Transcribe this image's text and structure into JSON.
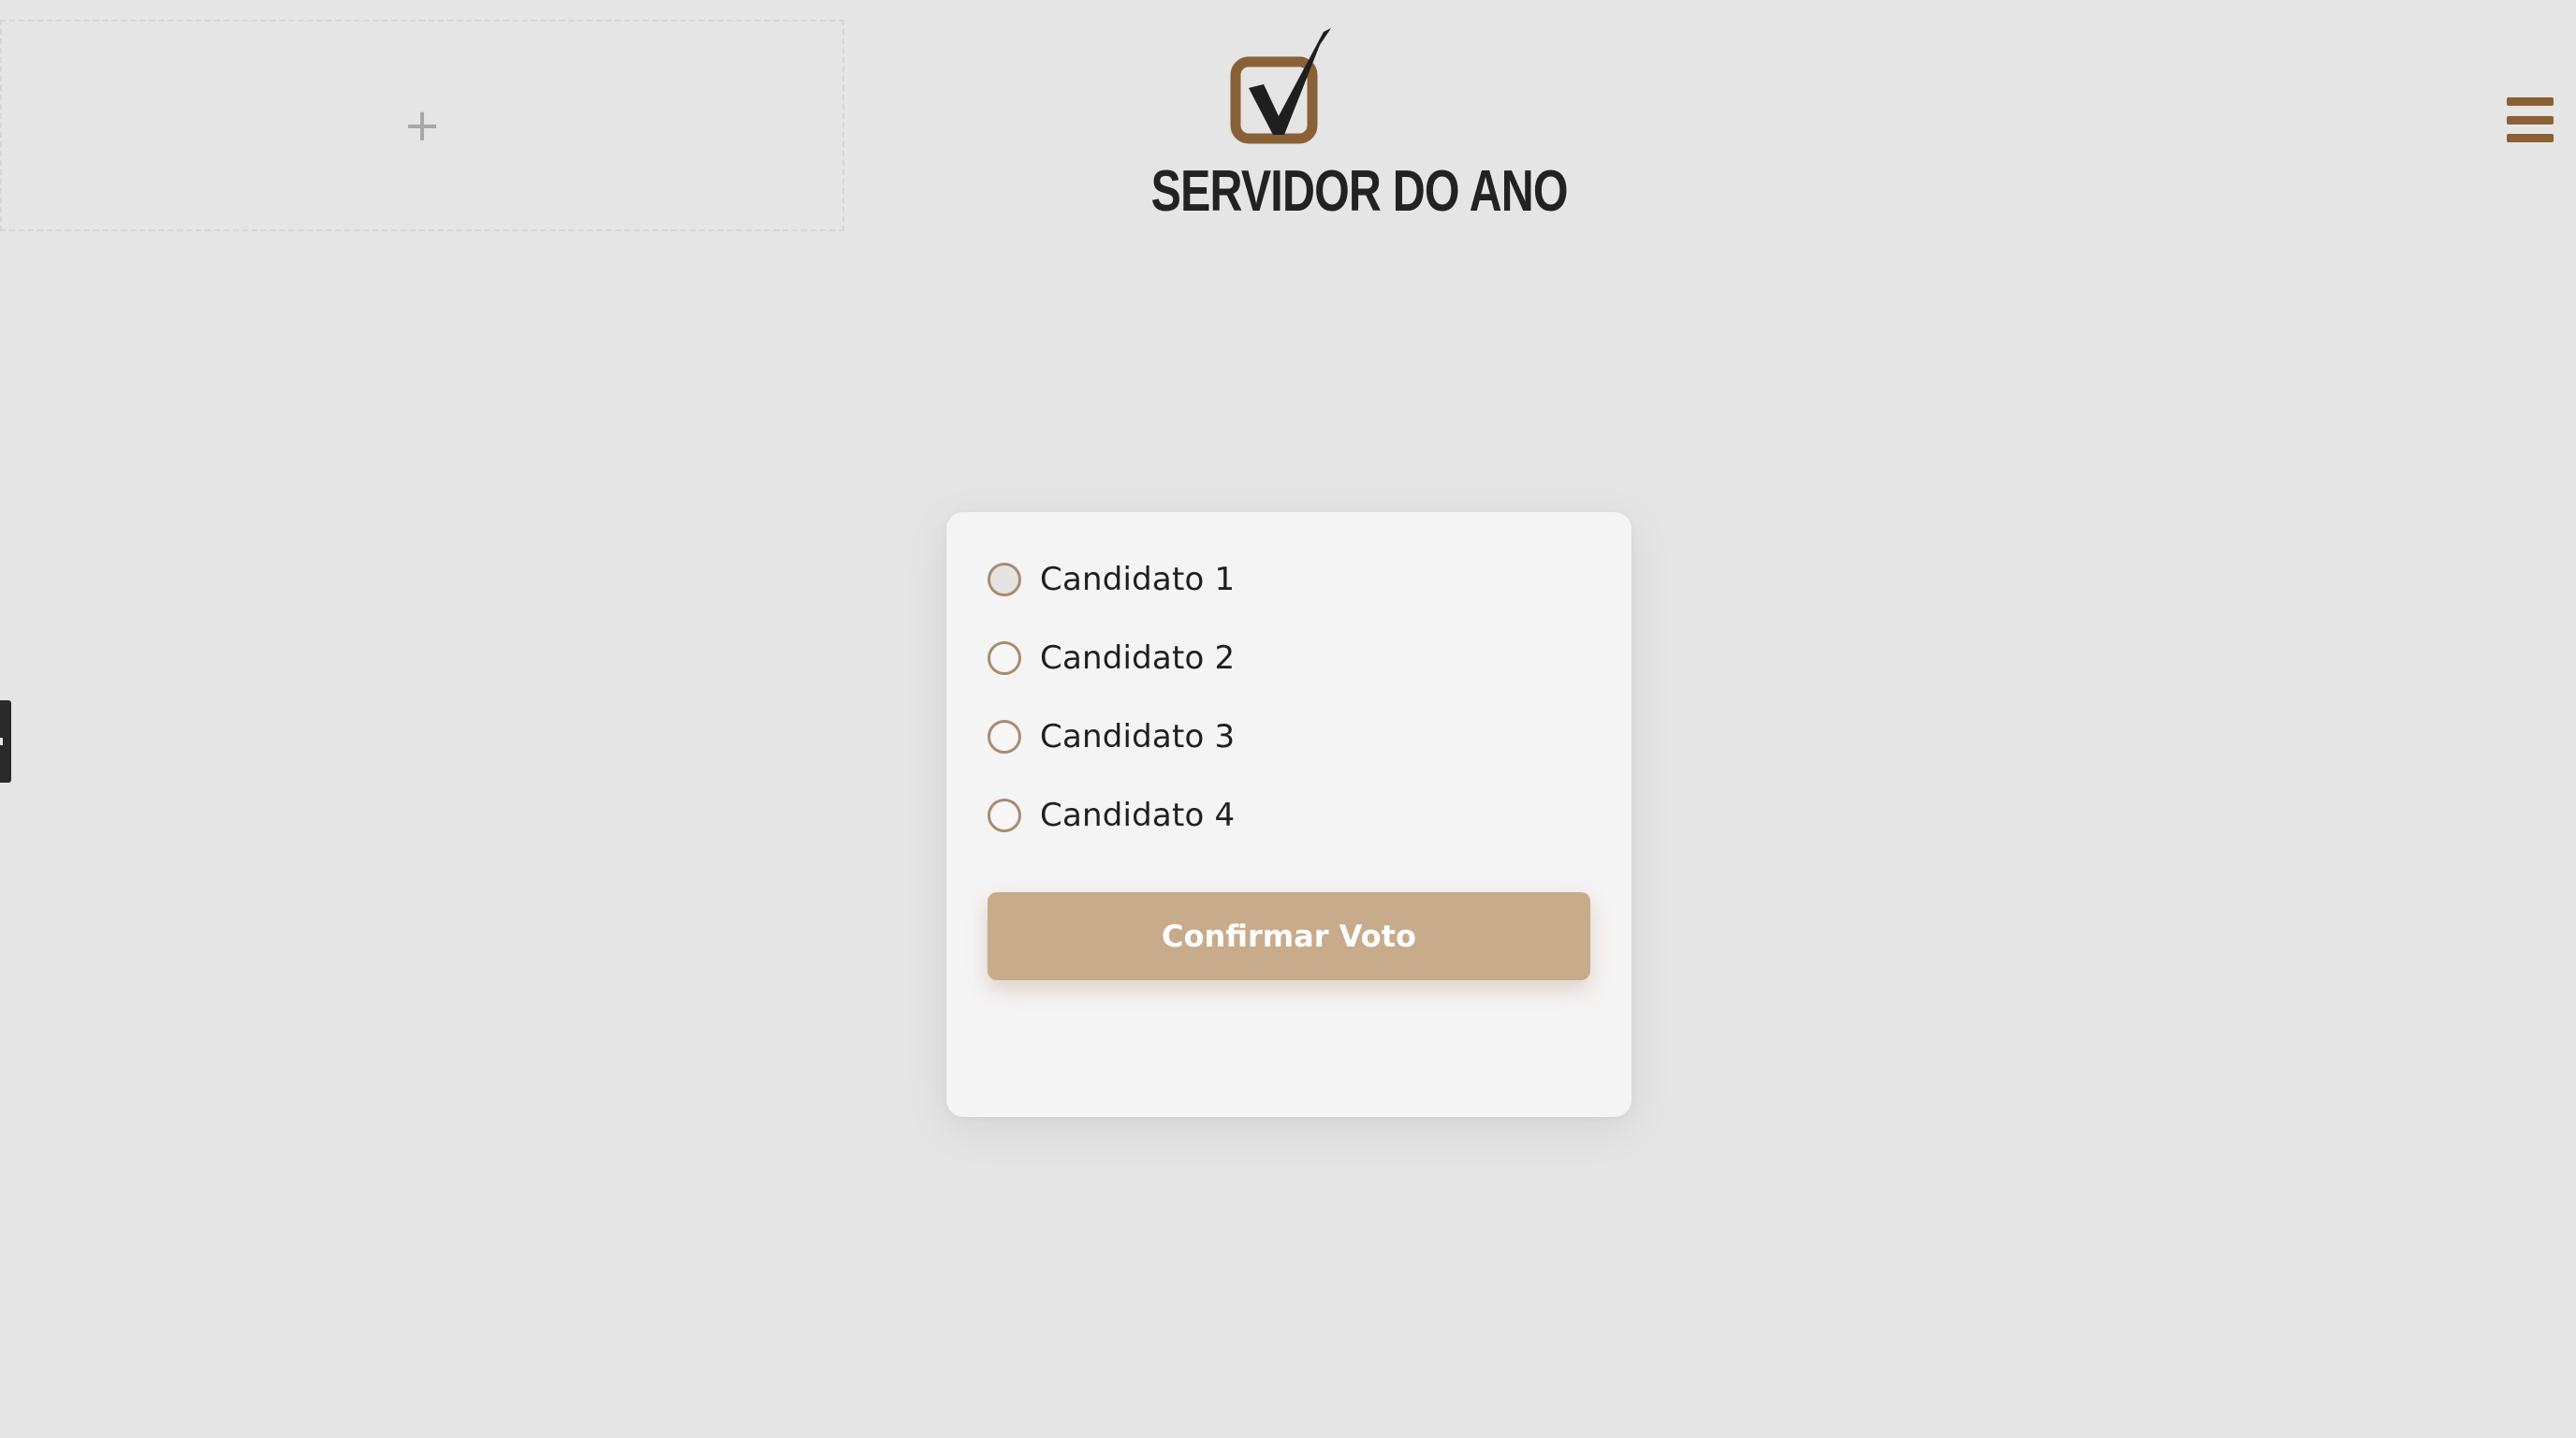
{
  "header": {
    "add_slot_symbol": "+",
    "brand_title": "SERVIDOR DO ANO",
    "logo_icon": "checkbox-check-icon",
    "menu_icon": "hamburger-menu-icon"
  },
  "colors": {
    "background": "#e5e5e5",
    "accent_brown": "#8a6137",
    "button": "#c8ab8b",
    "card": "#f5f4f4"
  },
  "vote_form": {
    "options": [
      {
        "label": "Candidato 1"
      },
      {
        "label": "Candidato 2"
      },
      {
        "label": "Candidato 3"
      },
      {
        "label": "Candidato 4"
      }
    ],
    "confirm_label": "Confirmar Voto"
  }
}
